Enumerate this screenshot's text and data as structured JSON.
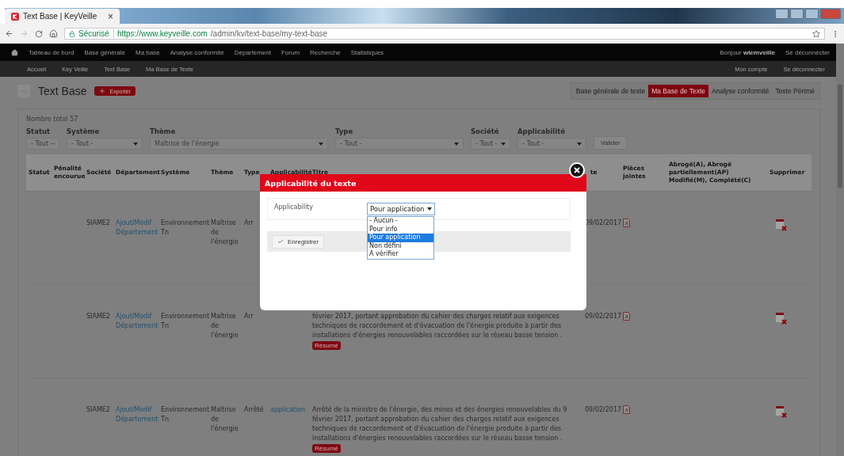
{
  "browser": {
    "tab": {
      "title": "Text Base | KeyVeille",
      "close": "×"
    },
    "address": {
      "security": "Sécurisé",
      "url_host": "https://www.keyveille.com",
      "url_path": "/admin/kv/text-base/my-text-base"
    }
  },
  "nav": {
    "items": [
      "Tableau de bord",
      "Base générale",
      "Ma base",
      "Analyse conformité",
      "Département",
      "Forum",
      "Recherche",
      "Statistiques"
    ],
    "greeting": "Bonjour **wiemveille**",
    "logout": "Se déconnecter"
  },
  "subnav": {
    "breadcrumb": [
      "Accueil",
      "Key Veille",
      "Text Base",
      "Ma Base de Texte"
    ],
    "links": [
      "Mon compte",
      "Se déconnecter"
    ]
  },
  "page": {
    "title": "Text Base",
    "export_button": "Exporter",
    "tabs": [
      {
        "label": "Base générale de texte",
        "selected": false
      },
      {
        "label": "Ma Base de Texte",
        "selected": true
      },
      {
        "label": "Analyse conformité",
        "selected": false
      },
      {
        "label": "Texte Périmé",
        "selected": false
      }
    ]
  },
  "summary": "Nombre total 57",
  "filters": [
    {
      "label": "Statut",
      "value": "- Tout -"
    },
    {
      "label": "Système",
      "value": "- Tout -"
    },
    {
      "label": "Thème",
      "value": "Maîtrise de l'énergie"
    },
    {
      "label": "Type",
      "value": "- Tout -"
    },
    {
      "label": "Société",
      "value": "- Tout -"
    },
    {
      "label": "Applicabilité",
      "value": "- Tout -"
    }
  ],
  "submit_button": "Valider",
  "table": {
    "columns": [
      "Statut",
      "Pénalité encourue",
      "Société",
      "Département",
      "Système",
      "Thème",
      "Type",
      "Applicabilité",
      "Titre",
      "te",
      "Pièces jointes",
      "Abrogé(A), Abrogé partiellement(AP) Modifié(M), Complété(C)",
      "Supprimer"
    ],
    "rows": [
      {
        "company": "SIAME2",
        "department": "Ajout/Modif Département",
        "system": "Environnement Tn",
        "theme": "Maîtrise de l'énergie",
        "type": "Arr",
        "date": "09/02/2017"
      },
      {
        "company": "SIAME2",
        "department": "Ajout/Modif Département",
        "system": "Environnement Tn",
        "theme": "Maîtrise de l'énergie",
        "type": "Arr",
        "title": "février 2017, portant approbation du cahier des charges relatif aux exigences techniques de raccordement et d'évacuation de l'énergie produite à partir des installations d'énergies renouvelables raccordées sur le réseau basse tension .",
        "summary_button": "Résumé",
        "date": "09/02/2017"
      },
      {
        "company": "SIAME2",
        "department": "Ajout/Modif Département",
        "system": "Environnement Tn",
        "theme": "Maîtrise de l'énergie",
        "type": "Arrêté",
        "applicability": "application",
        "title": "Arrêté de la ministre de l'énergie, des mines et des énergies renouvelables du 9 février 2017, portant approbation du cahier des charges relatif aux exigences techniques de raccordement et d'évacuation de l'énergie produite à partir des installations d'énergies renouvelables raccordées sur le réseau basse tension .",
        "summary_button": "Résumé",
        "date": "09/02/2017"
      }
    ]
  },
  "modal": {
    "title": "Applicabilité du texte",
    "field_label": "Applicability",
    "select_value": "Pour application",
    "options": [
      {
        "label": "- Aucun -",
        "selected": false
      },
      {
        "label": "Pour info",
        "selected": false
      },
      {
        "label": "Pour application",
        "selected": true
      },
      {
        "label": "Non défini",
        "selected": false
      },
      {
        "label": "A vérifier",
        "selected": false
      }
    ],
    "save_button": "Enregistrer"
  }
}
